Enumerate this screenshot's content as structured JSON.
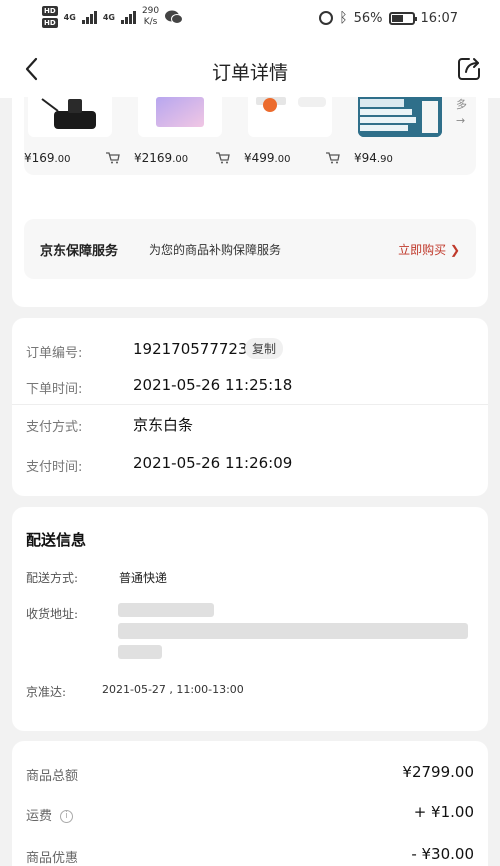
{
  "status_bar": {
    "hd1": "HD",
    "hd2": "HD",
    "net1": "4G",
    "net2": "4G",
    "speed_value": "290",
    "speed_unit": "K/s",
    "battery_percent": "56%",
    "battery_level": 0.56,
    "time": "16:07"
  },
  "nav": {
    "title": "订单详情"
  },
  "products": [
    {
      "price_main": "¥169",
      "price_decimal": ".00"
    },
    {
      "price_main": "¥2169",
      "price_decimal": ".00"
    },
    {
      "price_main": "¥499",
      "price_decimal": ".00"
    },
    {
      "price_main": "¥94",
      "price_decimal": ".90"
    }
  ],
  "more_label": "多",
  "guarantee": {
    "title": "京东保障服务",
    "desc": "为您的商品补购保障服务",
    "buy": "立即购买 ❯"
  },
  "order": {
    "number_label": "订单编号:",
    "number_value": "192170577723",
    "copy_label": "复制",
    "time_label": "下单时间:",
    "time_value": "2021-05-26 11:25:18",
    "pay_method_label": "支付方式:",
    "pay_method_value": "京东白条",
    "pay_time_label": "支付时间:",
    "pay_time_value": "2021-05-26 11:26:09"
  },
  "delivery": {
    "title": "配送信息",
    "method_label": "配送方式:",
    "method_value": "普通快递",
    "address_label": "收货地址:",
    "eta_label": "京准达:",
    "eta_value": "2021-05-27 , 11:00-13:00"
  },
  "summary": {
    "total_label": "商品总额",
    "total_value": "¥2799.00",
    "shipping_label": "运费",
    "shipping_value": "+ ¥1.00",
    "discount_label": "商品优惠",
    "discount_value": "- ¥30.00"
  }
}
